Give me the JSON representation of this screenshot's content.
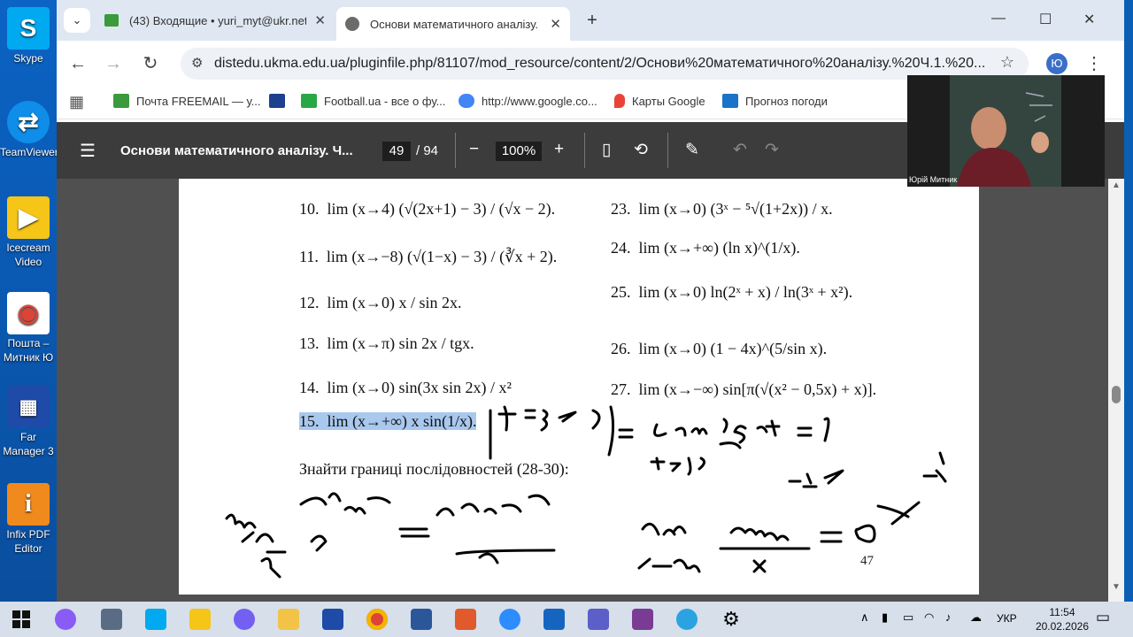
{
  "desktop": {
    "icons": [
      {
        "label": "Skype",
        "color": "#00a9f0",
        "glyph": "S"
      },
      {
        "label": "TeamViewer",
        "color": "#0e8ee9",
        "glyph": "⇄"
      },
      {
        "label": "Icecream Video Editor",
        "color": "#f5c518",
        "glyph": "▶"
      },
      {
        "label": "Пошта – Митник Ю",
        "color": "#ffffff",
        "glyph": "◉"
      },
      {
        "label": "Far Manager 3",
        "color": "#1e4aa8",
        "glyph": "▦"
      },
      {
        "label": "Infix PDF Editor",
        "color": "#f08a1c",
        "glyph": "i"
      }
    ]
  },
  "browser": {
    "tabs": [
      {
        "label": "(43) Входящие • yuri_myt@ukr.net",
        "active": false
      },
      {
        "label": "Основи математичного аналізу. Ч",
        "active": true
      }
    ],
    "new_tab": "+",
    "url": "distedu.ukma.edu.ua/pluginfile.php/81107/mod_resource/content/2/Основи%20математичного%20аналізу.%20Ч.1.%20...",
    "profile_initial": "Ю",
    "bookmarks": [
      {
        "label": "Почта FREEMAIL — у...",
        "color": "#3b9a3b"
      },
      {
        "label": "",
        "color": "#1d3f8f"
      },
      {
        "label": "Football.ua - все о фу...",
        "color": "#27a844"
      },
      {
        "label": "http://www.google.co...",
        "color": "#4285f4"
      },
      {
        "label": "Карты Google",
        "color": "#ea4335"
      },
      {
        "label": "Прогноз погоди",
        "color": "#1a73c8"
      }
    ]
  },
  "pdf": {
    "title": "Основи математичного аналізу. Ч...",
    "page_current": "49",
    "page_total": "/ 94",
    "zoom": "100%",
    "problems_left": [
      {
        "num": "10.",
        "expr": "lim (x→4) (√(2x+1) − 3) / (√x − 2)."
      },
      {
        "num": "11.",
        "expr": "lim (x→−8) (√(1−x) − 3) / (∛x + 2)."
      },
      {
        "num": "12.",
        "expr": "lim (x→0) x / sin 2x."
      },
      {
        "num": "13.",
        "expr": "lim (x→π) sin 2x / tgx."
      },
      {
        "num": "14.",
        "expr": "lim (x→0) sin(3x sin 2x) / x²"
      },
      {
        "num": "15.",
        "expr": "lim (x→+∞) x sin(1/x)."
      }
    ],
    "problems_right": [
      {
        "num": "23.",
        "expr": "lim (x→0) (3ˣ − ⁵√(1+2x)) / x."
      },
      {
        "num": "24.",
        "expr": "lim (x→+∞) (ln x)^(1/x)."
      },
      {
        "num": "25.",
        "expr": "lim (x→0) ln(2ˣ + x) / ln(3ˣ + x²)."
      },
      {
        "num": "26.",
        "expr": "lim (x→0) (1 − 4x)^(5/sin x)."
      },
      {
        "num": "27.",
        "expr": "lim (x→−∞) sin[π(√(x² − 0,5x) + x)]."
      }
    ],
    "heading": "Знайти границі послідовностей (28-30):",
    "page_number": "47"
  },
  "webcam": {
    "name": "Юрій Митник"
  },
  "taskbar": {
    "time": "11:54",
    "date": "20.02.2026",
    "lang": "УКР"
  }
}
